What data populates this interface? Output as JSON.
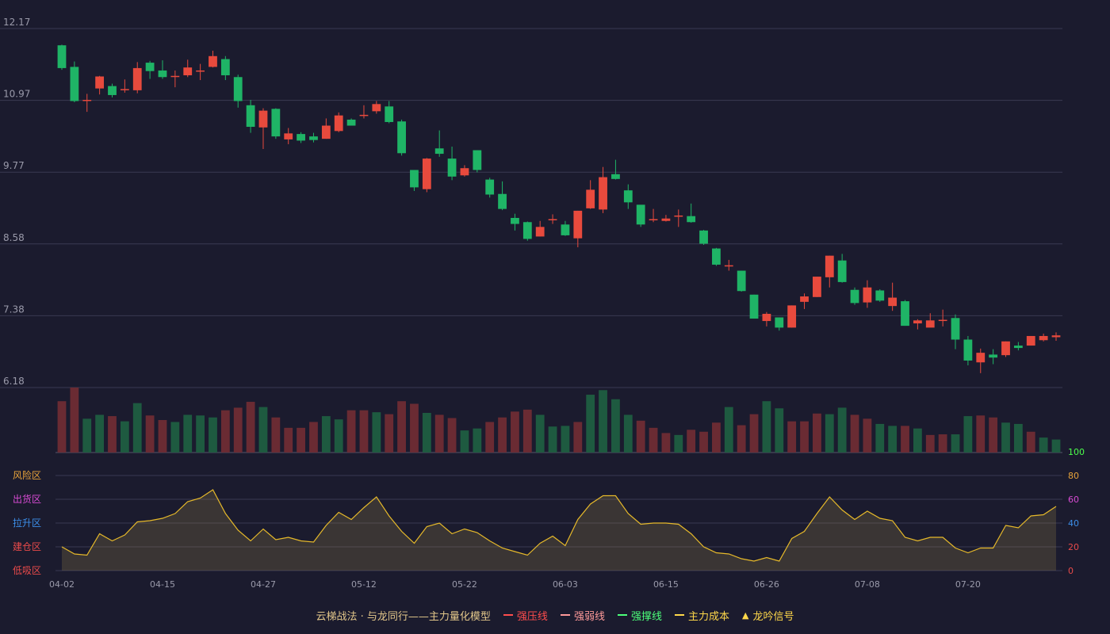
{
  "chart_data": [
    {
      "type": "candlestick",
      "x_tick_labels": [
        "04-02",
        "04-15",
        "04-27",
        "05-12",
        "05-22",
        "06-03",
        "06-15",
        "06-26",
        "07-08",
        "07-20"
      ],
      "y_tick_labels": [
        "12.17",
        "10.97",
        "9.77",
        "8.58",
        "7.38",
        "6.18"
      ],
      "ylim": [
        6.18,
        12.17
      ],
      "grid": true,
      "colors": {
        "up": "#e84a3d",
        "down": "#1fb466"
      },
      "ohlc": [
        [
          11.89,
          11.51,
          11.9,
          11.48
        ],
        [
          11.53,
          10.96,
          11.62,
          10.94
        ],
        [
          10.97,
          10.97,
          11.08,
          10.78
        ],
        [
          11.17,
          11.37,
          11.38,
          11.07
        ],
        [
          11.21,
          11.06,
          11.25,
          11.02
        ],
        [
          11.14,
          11.16,
          11.32,
          11.1
        ],
        [
          11.14,
          11.51,
          11.61,
          11.09
        ],
        [
          11.6,
          11.46,
          11.63,
          11.33
        ],
        [
          11.47,
          11.36,
          11.64,
          11.33
        ],
        [
          11.37,
          11.37,
          11.47,
          11.19
        ],
        [
          11.39,
          11.52,
          11.65,
          11.36
        ],
        [
          11.46,
          11.46,
          11.58,
          11.31
        ],
        [
          11.53,
          11.71,
          11.8,
          11.52
        ],
        [
          11.66,
          11.39,
          11.71,
          11.31
        ],
        [
          11.36,
          10.96,
          11.4,
          10.85
        ],
        [
          10.89,
          10.53,
          10.98,
          10.43
        ],
        [
          10.52,
          10.8,
          10.84,
          10.16
        ],
        [
          10.83,
          10.37,
          10.84,
          10.33
        ],
        [
          10.32,
          10.42,
          10.51,
          10.24
        ],
        [
          10.41,
          10.3,
          10.44,
          10.26
        ],
        [
          10.37,
          10.31,
          10.43,
          10.27
        ],
        [
          10.33,
          10.55,
          10.67,
          10.33
        ],
        [
          10.46,
          10.72,
          10.77,
          10.44
        ],
        [
          10.65,
          10.55,
          10.67,
          10.55
        ],
        [
          10.72,
          10.72,
          10.89,
          10.67
        ],
        [
          10.79,
          10.91,
          10.96,
          10.75
        ],
        [
          10.87,
          10.61,
          10.96,
          10.59
        ],
        [
          10.62,
          10.09,
          10.65,
          10.05
        ],
        [
          9.81,
          9.52,
          9.81,
          9.46
        ],
        [
          9.49,
          10.0,
          10.01,
          9.44
        ],
        [
          10.17,
          10.08,
          10.47,
          10.03
        ],
        [
          10.0,
          9.7,
          10.2,
          9.64
        ],
        [
          9.72,
          9.84,
          9.89,
          9.7
        ],
        [
          10.14,
          9.81,
          10.14,
          9.77
        ],
        [
          9.65,
          9.4,
          9.68,
          9.35
        ],
        [
          9.41,
          9.16,
          9.62,
          9.14
        ],
        [
          9.01,
          8.91,
          9.08,
          8.8
        ],
        [
          8.94,
          8.66,
          8.95,
          8.63
        ],
        [
          8.7,
          8.86,
          8.96,
          8.7
        ],
        [
          8.98,
          8.98,
          9.07,
          8.91
        ],
        [
          8.9,
          8.72,
          8.96,
          8.71
        ],
        [
          8.67,
          9.13,
          9.13,
          8.52
        ],
        [
          9.17,
          9.48,
          9.64,
          9.16
        ],
        [
          9.15,
          9.69,
          9.86,
          9.09
        ],
        [
          9.74,
          9.66,
          9.98,
          9.65
        ],
        [
          9.47,
          9.27,
          9.57,
          9.16
        ],
        [
          9.23,
          8.9,
          9.22,
          8.86
        ],
        [
          8.98,
          8.98,
          9.16,
          8.94
        ],
        [
          8.96,
          9.0,
          9.06,
          8.95
        ],
        [
          9.03,
          9.05,
          9.15,
          8.86
        ],
        [
          9.04,
          8.94,
          9.25,
          8.93
        ],
        [
          8.8,
          8.58,
          8.81,
          8.56
        ],
        [
          8.5,
          8.23,
          8.51,
          8.21
        ],
        [
          8.21,
          8.21,
          8.31,
          8.13
        ],
        [
          8.13,
          7.79,
          8.13,
          7.78
        ],
        [
          7.73,
          7.33,
          7.73,
          7.33
        ],
        [
          7.29,
          7.41,
          7.44,
          7.2
        ],
        [
          7.35,
          7.18,
          7.35,
          7.13
        ],
        [
          7.18,
          7.55,
          7.55,
          7.18
        ],
        [
          7.61,
          7.7,
          7.75,
          7.49
        ],
        [
          7.69,
          8.03,
          8.03,
          7.69
        ],
        [
          8.02,
          8.38,
          8.38,
          7.85
        ],
        [
          8.3,
          7.94,
          8.41,
          7.93
        ],
        [
          7.81,
          7.59,
          7.85,
          7.56
        ],
        [
          7.6,
          7.85,
          7.97,
          7.51
        ],
        [
          7.8,
          7.63,
          7.82,
          7.61
        ],
        [
          7.54,
          7.68,
          7.93,
          7.46
        ],
        [
          7.62,
          7.21,
          7.64,
          7.21
        ],
        [
          7.25,
          7.3,
          7.32,
          7.15
        ],
        [
          7.18,
          7.3,
          7.42,
          7.19
        ],
        [
          7.3,
          7.3,
          7.48,
          7.2
        ],
        [
          7.34,
          6.98,
          7.4,
          6.82
        ],
        [
          6.98,
          6.63,
          7.04,
          6.55
        ],
        [
          6.6,
          6.76,
          6.83,
          6.42
        ],
        [
          6.73,
          6.68,
          6.82,
          6.57
        ],
        [
          6.72,
          6.95,
          6.95,
          6.69
        ],
        [
          6.88,
          6.84,
          6.94,
          6.8
        ],
        [
          6.88,
          7.04,
          7.04,
          6.88
        ],
        [
          6.97,
          7.04,
          7.08,
          6.95
        ],
        [
          7.02,
          7.05,
          7.1,
          6.96
        ]
      ]
    },
    {
      "type": "bar",
      "name": "volume",
      "values": [
        79,
        100,
        52,
        58,
        56,
        48,
        76,
        57,
        50,
        47,
        58,
        57,
        54,
        65,
        69,
        78,
        70,
        54,
        38,
        38,
        47,
        56,
        51,
        65,
        65,
        62,
        59,
        79,
        75,
        61,
        58,
        53,
        34,
        37,
        47,
        54,
        63,
        66,
        58,
        40,
        41,
        47,
        89,
        96,
        82,
        58,
        49,
        38,
        30,
        27,
        35,
        32,
        46,
        70,
        42,
        59,
        79,
        68,
        48,
        48,
        60,
        59,
        69,
        58,
        52,
        44,
        41,
        41,
        37,
        27,
        28,
        28,
        56,
        57,
        54,
        46,
        44,
        32,
        23,
        20,
        25
      ],
      "colors": [
        "up",
        "up",
        "down",
        "down",
        "up",
        "down",
        "down",
        "up",
        "up",
        "down",
        "down",
        "down",
        "down",
        "up",
        "up",
        "up",
        "down",
        "up",
        "up",
        "up",
        "up",
        "down",
        "down",
        "up",
        "up",
        "down",
        "up",
        "up",
        "up",
        "down",
        "up",
        "up",
        "down",
        "down",
        "up",
        "up",
        "up",
        "up",
        "down",
        "down",
        "down",
        "up",
        "down",
        "down",
        "down",
        "down",
        "up",
        "up",
        "up",
        "down",
        "up",
        "up",
        "up",
        "down",
        "up",
        "up",
        "down",
        "down",
        "up",
        "up",
        "up",
        "down",
        "down",
        "up",
        "up",
        "down",
        "down",
        "up",
        "down",
        "up",
        "up",
        "down",
        "down",
        "up",
        "up",
        "down",
        "down",
        "up",
        "down",
        "down",
        "down"
      ],
      "ylim": [
        0,
        100
      ]
    },
    {
      "type": "area",
      "name": "oscillator",
      "y_tick_labels": [
        "100",
        "80",
        "60",
        "40",
        "20",
        "0"
      ],
      "zone_labels": [
        "风险区",
        "出货区",
        "拉升区",
        "建仓区",
        "低吸区"
      ],
      "ylim": [
        0,
        100
      ],
      "values": [
        20,
        14,
        13,
        31,
        25,
        30,
        41,
        42,
        44,
        48,
        58,
        61,
        68,
        48,
        34,
        25,
        35,
        26,
        28,
        25,
        24,
        38,
        49,
        43,
        53,
        62,
        46,
        33,
        23,
        37,
        40,
        31,
        35,
        32,
        25,
        19,
        16,
        13,
        23,
        29,
        21,
        43,
        56,
        63,
        63,
        48,
        39,
        40,
        40,
        39,
        31,
        20,
        15,
        14,
        10,
        8,
        11,
        8,
        27,
        33,
        48,
        62,
        51,
        43,
        50,
        44,
        42,
        28,
        25,
        28,
        28,
        19,
        15,
        19,
        19,
        38,
        36,
        46,
        47,
        54
      ]
    }
  ],
  "zone_colors": [
    "#e8a33a",
    "#d84bd4",
    "#3c8ee8",
    "#e84a4a",
    "#e84a4a"
  ],
  "legend": {
    "title": "云梯战法 · 与龙同行——主力量化模型",
    "items": [
      {
        "label": "强压线",
        "color": "#ff4d4d",
        "style": "solid"
      },
      {
        "label": "强弱线",
        "color": "#ff9a9a",
        "style": "dashed"
      },
      {
        "label": "强撑线",
        "color": "#4cff7a",
        "style": "solid"
      },
      {
        "label": "主力成本",
        "color": "#ffd84a",
        "style": "dashed"
      },
      {
        "label": "龙吟信号",
        "color": "#ffd84a",
        "style": "triangle"
      }
    ]
  }
}
